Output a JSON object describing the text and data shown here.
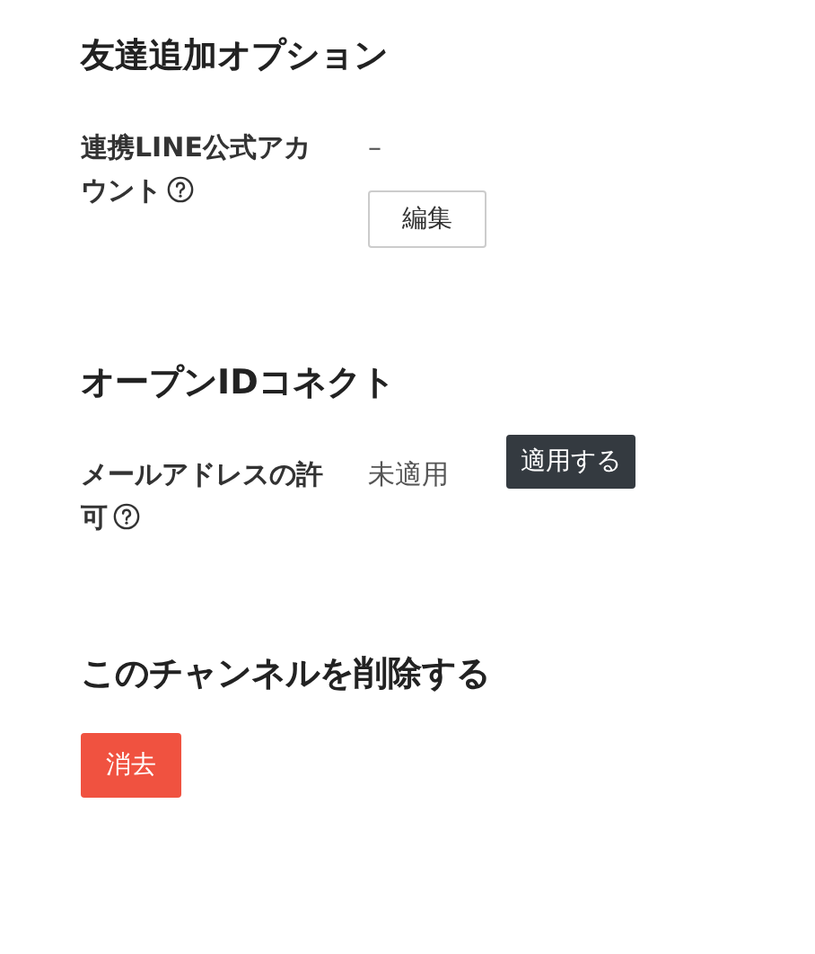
{
  "sections": [
    {
      "title": "友達追加オプション",
      "settings": [
        {
          "label": "連携LINE公式アカウント",
          "help": true,
          "value": "–",
          "kind": "stacked",
          "button": {
            "label": "編集",
            "kind": "outline"
          }
        }
      ]
    },
    {
      "title": "オープンIDコネクト",
      "settings": [
        {
          "label": "メールアドレスの許可",
          "help": true,
          "value": "未適用",
          "kind": "inline",
          "button": {
            "label": "適用する",
            "kind": "dark"
          }
        }
      ]
    },
    {
      "title": "このチャンネルを削除する",
      "button": {
        "label": "消去",
        "kind": "danger"
      }
    }
  ]
}
